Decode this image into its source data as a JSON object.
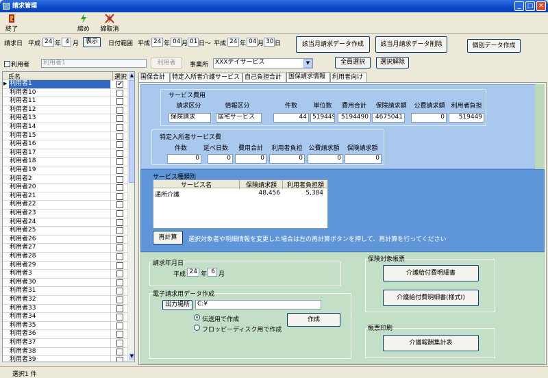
{
  "window": {
    "title": "請求管理"
  },
  "toolbar": {
    "exit": "終了",
    "close_month": "締め",
    "cancel_close": "締取消"
  },
  "filter": {
    "billing_date_label": "請求日",
    "era1": "平成",
    "year1": "24",
    "year_unit": "年",
    "month1": "4",
    "month_unit": "月",
    "show_btn": "表示",
    "range_label": "日付範囲",
    "from_era": "平成",
    "from_year": "24",
    "from_month": "04",
    "from_day": "01",
    "day_unit": "日",
    "tilde": "～",
    "to_era": "平成",
    "to_year": "24",
    "to_month": "04",
    "to_day": "30",
    "user_check": "利用者",
    "user_placeholder": "利用者1",
    "user_btn": "利用者",
    "office_label": "事業所",
    "office_value": "XXXデイサービス",
    "create_btn": "該当月請求データ作成",
    "delete_btn": "該当月請求データ削除",
    "individual_btn": "個別データ作成",
    "select_all_btn": "全員選択",
    "clear_btn": "選択解除"
  },
  "list": {
    "col_name": "氏名",
    "col_select": "選択",
    "rows": [
      {
        "name": "利用者1",
        "checked": "✔"
      },
      {
        "name": "利用者10",
        "checked": ""
      },
      {
        "name": "利用者11",
        "checked": ""
      },
      {
        "name": "利用者12",
        "checked": ""
      },
      {
        "name": "利用者13",
        "checked": ""
      },
      {
        "name": "利用者14",
        "checked": ""
      },
      {
        "name": "利用者15",
        "checked": ""
      },
      {
        "name": "利用者16",
        "checked": ""
      },
      {
        "name": "利用者17",
        "checked": ""
      },
      {
        "name": "利用者18",
        "checked": ""
      },
      {
        "name": "利用者19",
        "checked": ""
      },
      {
        "name": "利用者2",
        "checked": ""
      },
      {
        "name": "利用者20",
        "checked": ""
      },
      {
        "name": "利用者21",
        "checked": ""
      },
      {
        "name": "利用者22",
        "checked": ""
      },
      {
        "name": "利用者23",
        "checked": ""
      },
      {
        "name": "利用者24",
        "checked": ""
      },
      {
        "name": "利用者25",
        "checked": ""
      },
      {
        "name": "利用者26",
        "checked": ""
      },
      {
        "name": "利用者27",
        "checked": ""
      },
      {
        "name": "利用者28",
        "checked": ""
      },
      {
        "name": "利用者29",
        "checked": ""
      },
      {
        "name": "利用者3",
        "checked": ""
      },
      {
        "name": "利用者30",
        "checked": ""
      },
      {
        "name": "利用者31",
        "checked": ""
      },
      {
        "name": "利用者32",
        "checked": ""
      },
      {
        "name": "利用者33",
        "checked": ""
      },
      {
        "name": "利用者34",
        "checked": ""
      },
      {
        "name": "利用者35",
        "checked": ""
      },
      {
        "name": "利用者36",
        "checked": ""
      },
      {
        "name": "利用者37",
        "checked": ""
      },
      {
        "name": "利用者38",
        "checked": ""
      },
      {
        "name": "利用者39",
        "checked": ""
      }
    ]
  },
  "tabs": [
    "国保合計",
    "特定入所者介護サービス",
    "自己負担合計",
    "国保請求情報",
    "利用者向け"
  ],
  "service_cost": {
    "title": "サービス費用",
    "headers": [
      "請求区分",
      "情報区分",
      "件数",
      "単位数",
      "費用合計",
      "保険請求額",
      "公費請求額",
      "利用者負担"
    ],
    "values": [
      "保険請求",
      "居宅サービス",
      "44",
      "519449",
      "5194490",
      "4675041",
      "0",
      "519449"
    ]
  },
  "special": {
    "title": "特定入所者サービス費",
    "headers": [
      "件数",
      "延べ日数",
      "費用合計",
      "利用者負担",
      "公費請求額",
      "保険請求額"
    ],
    "values": [
      "0",
      "0",
      "0",
      "0",
      "0",
      "0"
    ]
  },
  "by_type": {
    "title": "サービス種類別",
    "headers": [
      "サービス名",
      "保険請求額",
      "利用者負担額"
    ],
    "rows": [
      [
        "通所介護",
        "48,456",
        "5,384"
      ]
    ]
  },
  "recalc": {
    "btn": "再計算",
    "note": "選択対象者や明細情報を変更した場合は左の再計算ボタンを押して、再計算を行ってください"
  },
  "billing_ym": {
    "title": "請求年月日",
    "era": "平成",
    "year": "24",
    "year_unit": "年",
    "month": "6",
    "month_unit": "月"
  },
  "edata": {
    "title": "電子請求用データ作成",
    "output_btn": "出力場所",
    "path": "C:¥",
    "opt1": "伝送用で作成",
    "opt2": "フロッピーディスク用で作成",
    "create_btn": "作成"
  },
  "insured": {
    "title": "保険対象帳票",
    "btn1": "介護給付費明細書",
    "btn2": "介護給付費明細書(様式Ⅰ)"
  },
  "print": {
    "title": "帳票印刷",
    "btn": "介護報酬集計表"
  },
  "status": {
    "text": "選択1 件"
  }
}
